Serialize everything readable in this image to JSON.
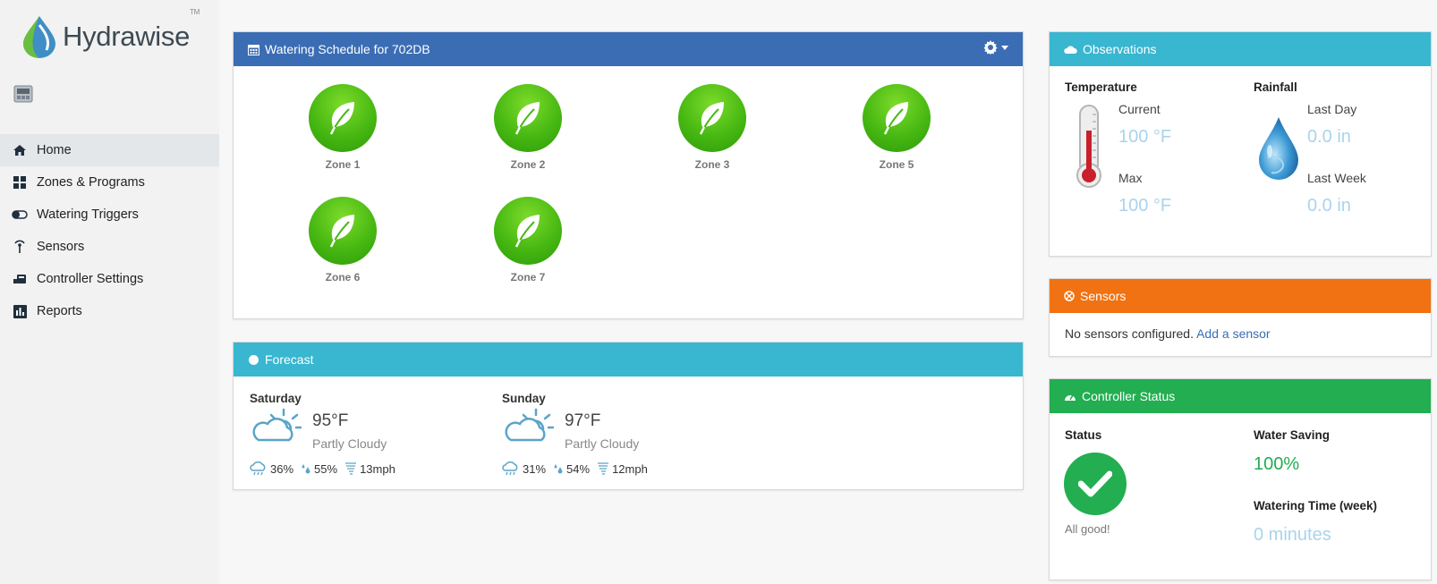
{
  "brand": {
    "name_part1": "Hydra",
    "name_part2": "wise",
    "tm": "TM"
  },
  "nav": {
    "items": [
      {
        "label": "Home",
        "icon": "home-icon",
        "active": true
      },
      {
        "label": "Zones & Programs",
        "icon": "zones-icon"
      },
      {
        "label": "Watering Triggers",
        "icon": "toggle-icon"
      },
      {
        "label": "Sensors",
        "icon": "sensor-antenna-icon"
      },
      {
        "label": "Controller Settings",
        "icon": "controller-icon"
      },
      {
        "label": "Reports",
        "icon": "bar-chart-icon"
      }
    ]
  },
  "schedule": {
    "title": "Watering Schedule for 702DB",
    "zones": [
      "Zone 1",
      "Zone 2",
      "Zone 3",
      "Zone 5",
      "Zone 6",
      "Zone 7"
    ]
  },
  "forecast": {
    "title": "Forecast",
    "days": [
      {
        "day": "Saturday",
        "temp": "95°F",
        "condition": "Partly Cloudy",
        "rain": "36%",
        "humidity": "55%",
        "wind": "13mph"
      },
      {
        "day": "Sunday",
        "temp": "97°F",
        "condition": "Partly Cloudy",
        "rain": "31%",
        "humidity": "54%",
        "wind": "12mph"
      }
    ]
  },
  "observations": {
    "title": "Observations",
    "temperature_title": "Temperature",
    "rainfall_title": "Rainfall",
    "current_label": "Current",
    "current_value": "100 °F",
    "max_label": "Max",
    "max_value": "100 °F",
    "last_day_label": "Last Day",
    "last_day_value": "0.0 in",
    "last_week_label": "Last Week",
    "last_week_value": "0.0 in"
  },
  "sensors": {
    "title": "Sensors",
    "message": "No sensors configured.",
    "link": "Add a sensor"
  },
  "controller_status": {
    "title": "Controller Status",
    "status_title": "Status",
    "status_text": "All good!",
    "water_saving_title": "Water Saving",
    "water_saving_value": "100%",
    "watering_time_title": "Watering Time (week)",
    "watering_time_value": "0 minutes"
  },
  "colors": {
    "schedule_header": "#3b6db4",
    "forecast_header": "#39b6d0",
    "sensors_header": "#f07212",
    "status_header": "#22ae51",
    "zone_green": "#47b812",
    "water_saving": "#22ae51",
    "observation_value": "#a9d4ec"
  }
}
